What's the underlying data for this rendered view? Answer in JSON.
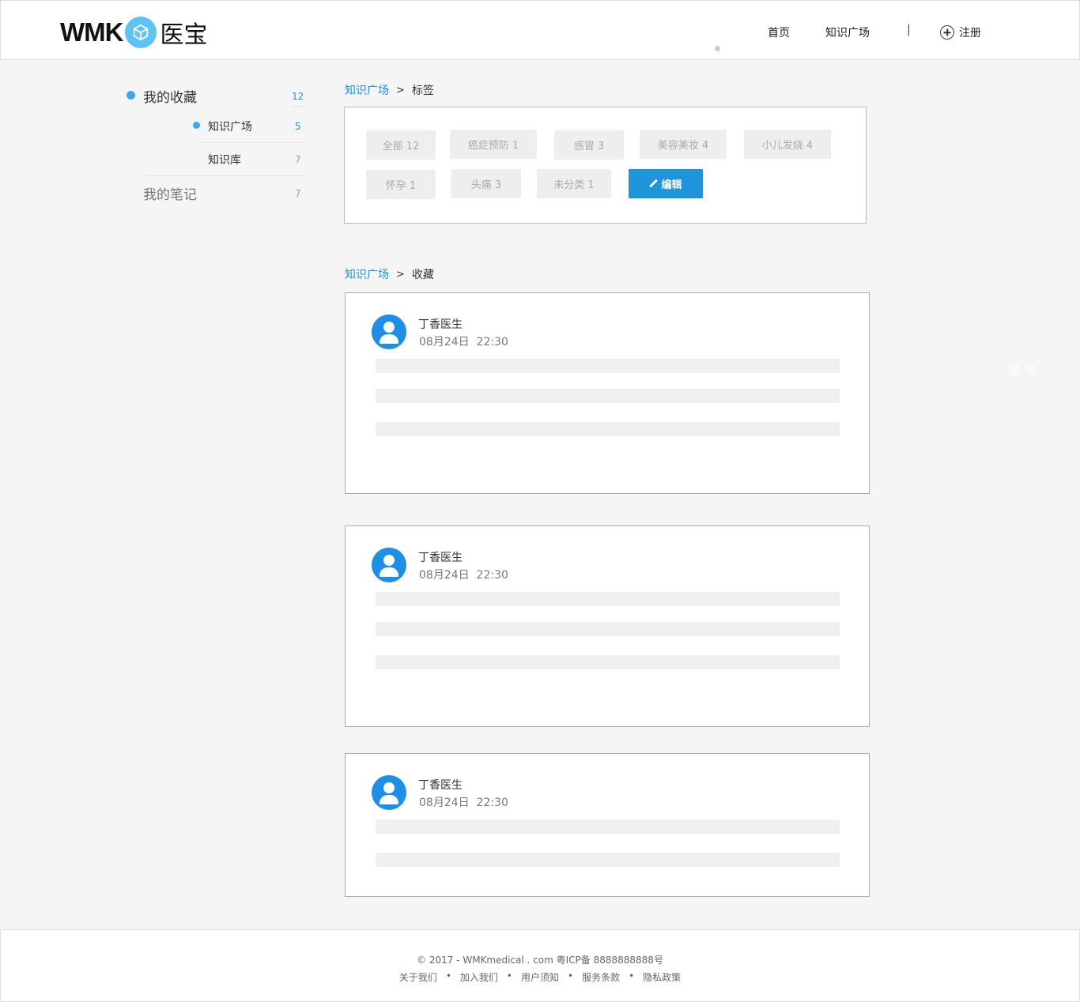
{
  "brand": {
    "latin": "WMK",
    "cn": "医宝"
  },
  "nav": {
    "home": "首页",
    "square": "知识广场",
    "separator": "|",
    "register": "注册"
  },
  "sidebar": {
    "favorites": {
      "label": "我的收藏",
      "count": "12"
    },
    "square": {
      "label": "知识广场",
      "count": "5"
    },
    "library": {
      "label": "知识库",
      "count": "7"
    },
    "notes": {
      "label": "我的笔记",
      "count": "7"
    }
  },
  "tags_section": {
    "breadcrumb": {
      "root": "知识广场",
      "sep": ">",
      "current": "标签"
    },
    "tags": [
      "全部 12",
      "癌症预防 1",
      "感冒 3",
      "美容美妆 4",
      "小儿发烧 4",
      "怀孕 1",
      "头痛 3",
      "未分类 1"
    ],
    "edit_label": "编辑"
  },
  "favorites_section": {
    "breadcrumb": {
      "root": "知识广场",
      "sep": ">",
      "current": "收藏"
    },
    "cards": [
      {
        "author": "丁香医生",
        "date": "08月24日",
        "time": "22:30"
      },
      {
        "author": "丁香医生",
        "date": "08月24日",
        "time": "22:30"
      },
      {
        "author": "丁香医生",
        "date": "08月24日",
        "time": "22:30"
      }
    ]
  },
  "float": {
    "login": "登录"
  },
  "footer": {
    "copyright": "© 2017 - WMKmedical . com 粤ICP备 8888888888号",
    "links": [
      "关于我们",
      "加入我们",
      "用户须知",
      "服务条款",
      "隐私政策"
    ],
    "separator": "•"
  },
  "colors": {
    "accent": "#1e95db",
    "dot": "#3aa9f0",
    "logo_badge": "#5bc4f4"
  }
}
